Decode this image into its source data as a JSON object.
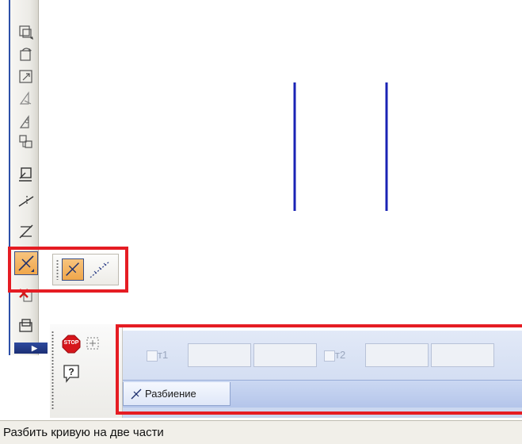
{
  "window": {
    "status_text": "Разбить кривую на две части"
  },
  "left_toolbar": {
    "icons": [
      "zoom-region-icon",
      "rotate-icon",
      "scale-icon",
      "mirror-icon",
      "copy-icon",
      "edit-point-icon",
      "trim-icon",
      "extend-icon",
      "split-curve-icon",
      "delete-part-icon",
      "clipping-icon"
    ]
  },
  "split_popup": {
    "options": [
      "split-curve-icon",
      "split-curve-n-parts-icon"
    ]
  },
  "property_bar": {
    "point1_label": "т1",
    "point2_label": "т2",
    "tab_label": "Разбиение"
  },
  "colors": {
    "highlight_frame": "#e51c23",
    "drawing_line": "#1a23b5",
    "active_button": "#f0a64a",
    "panel_blue": "#c9d6ef"
  }
}
